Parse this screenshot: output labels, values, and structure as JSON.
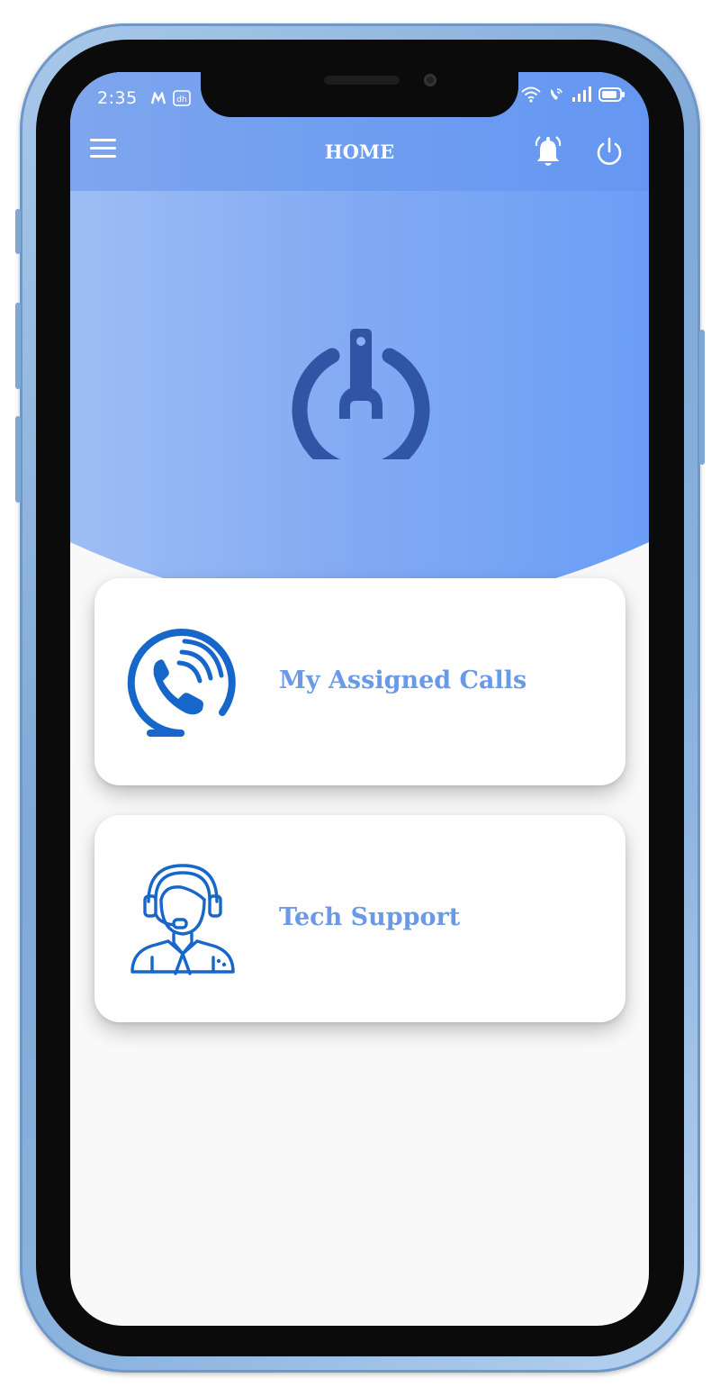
{
  "status_bar": {
    "time": "2:35",
    "left_icons": [
      "m-notification-icon",
      "app-notification-icon"
    ],
    "right_icons": [
      "wifi-icon",
      "wifi-calling-icon",
      "signal-icon",
      "battery-icon"
    ]
  },
  "app_bar": {
    "title": "HOME",
    "menu_icon": "hamburger-menu-icon",
    "notification_icon": "bell-icon",
    "logout_icon": "power-icon"
  },
  "hero": {
    "logo_icon": "power-wrench-logo"
  },
  "cards": [
    {
      "label": "My Assigned Calls",
      "icon": "phone-call-icon"
    },
    {
      "label": "Tech Support",
      "icon": "support-agent-icon"
    }
  ],
  "colors": {
    "header_gradient_start": "#9dbdf4",
    "header_gradient_end": "#6b9ef6",
    "logo": "#2f55a4",
    "card_icon": "#1766c9",
    "card_label": "#6a99e6",
    "phone_frame": "#8cb4df"
  }
}
